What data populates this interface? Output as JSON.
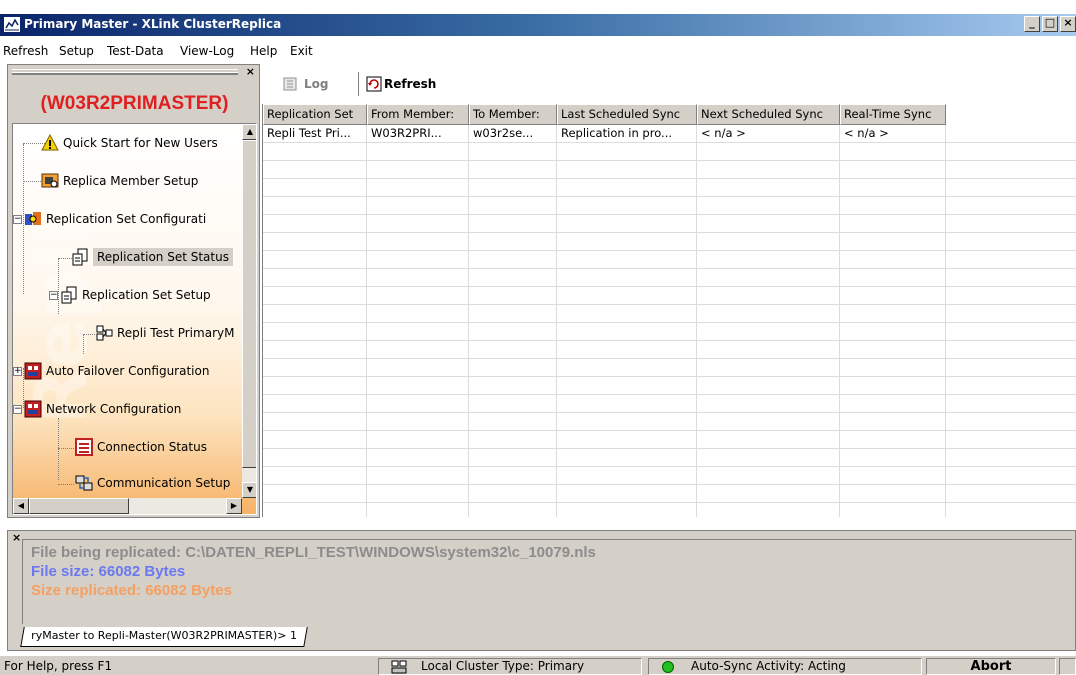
{
  "window": {
    "title": "Primary Master - XLink ClusterReplica",
    "minimize": "_",
    "maximize": "□",
    "close": "×"
  },
  "menu": {
    "items": [
      "Refresh",
      "Setup",
      "Test-Data",
      "View-Log",
      "Help",
      "Exit"
    ]
  },
  "left_pane": {
    "close": "×",
    "host": "(W03R2PRIMASTER)",
    "watermark": "Repli",
    "tree": [
      {
        "label": "Quick Start for New Users",
        "icon": "warning-icon"
      },
      {
        "label": "Replica Member Setup",
        "icon": "member-setup-icon"
      },
      {
        "label": "Replication Set Configurati",
        "icon": "configuration-icon"
      },
      {
        "label": "Replication Set Status",
        "icon": "replication-status-icon",
        "selected": true
      },
      {
        "label": "Replication Set Setup",
        "icon": "replication-setup-icon"
      },
      {
        "label": "Repli Test PrimaryM",
        "icon": "replication-set-icon"
      },
      {
        "label": "Auto Failover Configuration",
        "icon": "failover-icon"
      },
      {
        "label": "Network Configuration",
        "icon": "network-icon"
      },
      {
        "label": "Connection Status",
        "icon": "connection-status-icon"
      },
      {
        "label": "Communication Setup",
        "icon": "communication-icon"
      }
    ]
  },
  "toolbar": {
    "log_label": "Log",
    "refresh_label": "Refresh"
  },
  "grid": {
    "columns": [
      "Replication Set",
      "From Member:",
      "To Member:",
      "Last Scheduled Sync",
      "Next Scheduled Sync",
      "Real-Time Sync"
    ],
    "rows": [
      [
        "Repli Test Pri...",
        "W03R2PRI...",
        "w03r2se...",
        "Replication in pro...",
        "< n/a >",
        "< n/a >"
      ]
    ]
  },
  "log": {
    "close": "×",
    "file_line": "File being replicated: C:\\DATEN_REPLI_TEST\\WINDOWS\\system32\\c_10079.nls",
    "size_line": "File size: 66082 Bytes",
    "replicated_line": "Size replicated: 66082 Bytes",
    "tab_label": "ryMaster to Repli-Master(W03R2PRIMASTER)> 1",
    "colors": {
      "file": "#8c8c8c",
      "size": "#6b78f0",
      "replicated": "#f5a062"
    }
  },
  "status": {
    "help": "For Help, press F1",
    "cluster_type": "Local Cluster Type: Primary",
    "activity": "Auto-Sync Activity: Acting",
    "abort": "Abort"
  }
}
